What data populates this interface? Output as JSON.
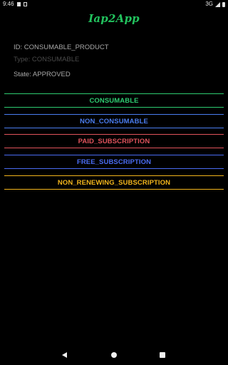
{
  "status_bar": {
    "time": "9:46",
    "network": "3G"
  },
  "app": {
    "title": "Iap2App"
  },
  "product_info": {
    "id": "ID: CONSUMABLE_PRODUCT",
    "type": "Type: CONSUMABLE",
    "state": "State: APPROVED"
  },
  "products": [
    {
      "label": "CONSUMABLE",
      "color": "#2ecc71"
    },
    {
      "label": "NON_CONSUMABLE",
      "color": "#4a7df0"
    },
    {
      "label": "PAID_SUBSCRIPTION",
      "color": "#e0535c"
    },
    {
      "label": "FREE_SUBSCRIPTION",
      "color": "#4a6cf2"
    },
    {
      "label": "NON_RENEWING_SUBSCRIPTION",
      "color": "#f2b51c"
    }
  ],
  "icons": {
    "status": [
      "notification-box-icon",
      "notification-b-icon",
      "signal-icon",
      "battery-icon"
    ],
    "nav": [
      "back-icon",
      "home-icon",
      "recents-icon"
    ]
  }
}
